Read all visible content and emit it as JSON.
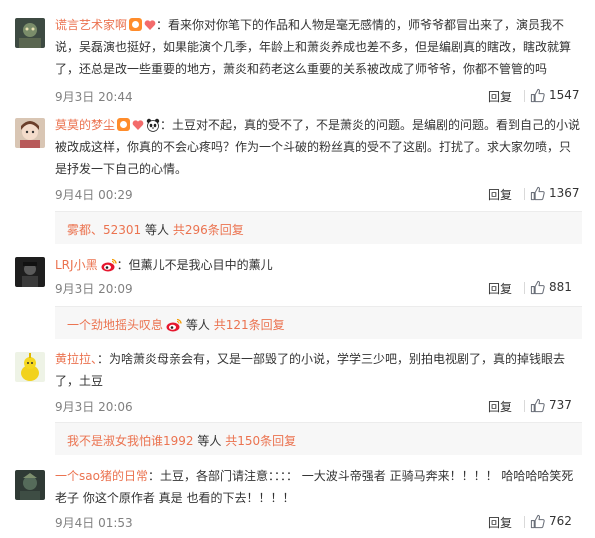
{
  "comments": [
    {
      "username": "谎言艺术家啊",
      "body": "：看来你对你笔下的作品和人物是毫无感情的，师爷爷都冒出来了，演员我不说，吴磊演也挺好，如果能演个几季，年龄上和萧炎养成也差不多，但是编剧真的瞎改，瞎改就算了，还总是改一些重要的地方，萧炎和药老这么重要的关系被改成了师爷爷，你都不管管的吗",
      "time": "9月3日 20:44",
      "reply_label": "回复",
      "likes": "1547"
    },
    {
      "username": "莫莫的梦尘",
      "body": "：土豆对不起，真的受不了，不是萧炎的问题。是编剧的问题。看到自己的小说被改成这样，你真的不会心疼吗？作为一个斗破的粉丝真的受不了这剧。打扰了。求大家勿喷，只是抒发一下自己的心情。",
      "time": "9月4日 00:29",
      "reply_label": "回复",
      "likes": "1367",
      "sub": {
        "user": "雾都、52301",
        "mid": "等人",
        "count": "共296条回复"
      }
    },
    {
      "username": "LRJ小黑",
      "body": "：但薰儿不是我心目中的薰儿",
      "time": "9月3日 20:09",
      "reply_label": "回复",
      "likes": "881",
      "sub": {
        "user": "一个劲地摇头叹息",
        "mid": "等人",
        "count": "共121条回复"
      }
    },
    {
      "username": "黄拉拉、",
      "body": "：为啥萧炎母亲会有，又是一部毁了的小说，学学三少吧，别拍电视剧了，真的掉钱眼去了，土豆",
      "time": "9月3日 20:06",
      "reply_label": "回复",
      "likes": "737",
      "sub": {
        "user": "我不是淑女我怕谁1992",
        "mid": "等人",
        "count": "共150条回复"
      }
    },
    {
      "username": "一个sao猪的日常",
      "body": "：土豆，各部门请注意：：：：  一大波斗帝强者 正骑马奔来！！！！  哈哈哈哈笑死老子 你这个原作者 真是 也看的下去！！！！",
      "time": "9月4日 01:53",
      "reply_label": "回复",
      "likes": "762"
    }
  ],
  "icons": {
    "like": "thumbs-up-icon",
    "badge": "vip-badge-icon",
    "heart": "heart-icon",
    "panda": "panda-icon",
    "weibo": "weibo-icon"
  },
  "colors": {
    "username": "#eb7350",
    "meta": "#808080",
    "sub_bg": "#f7f7f7"
  }
}
